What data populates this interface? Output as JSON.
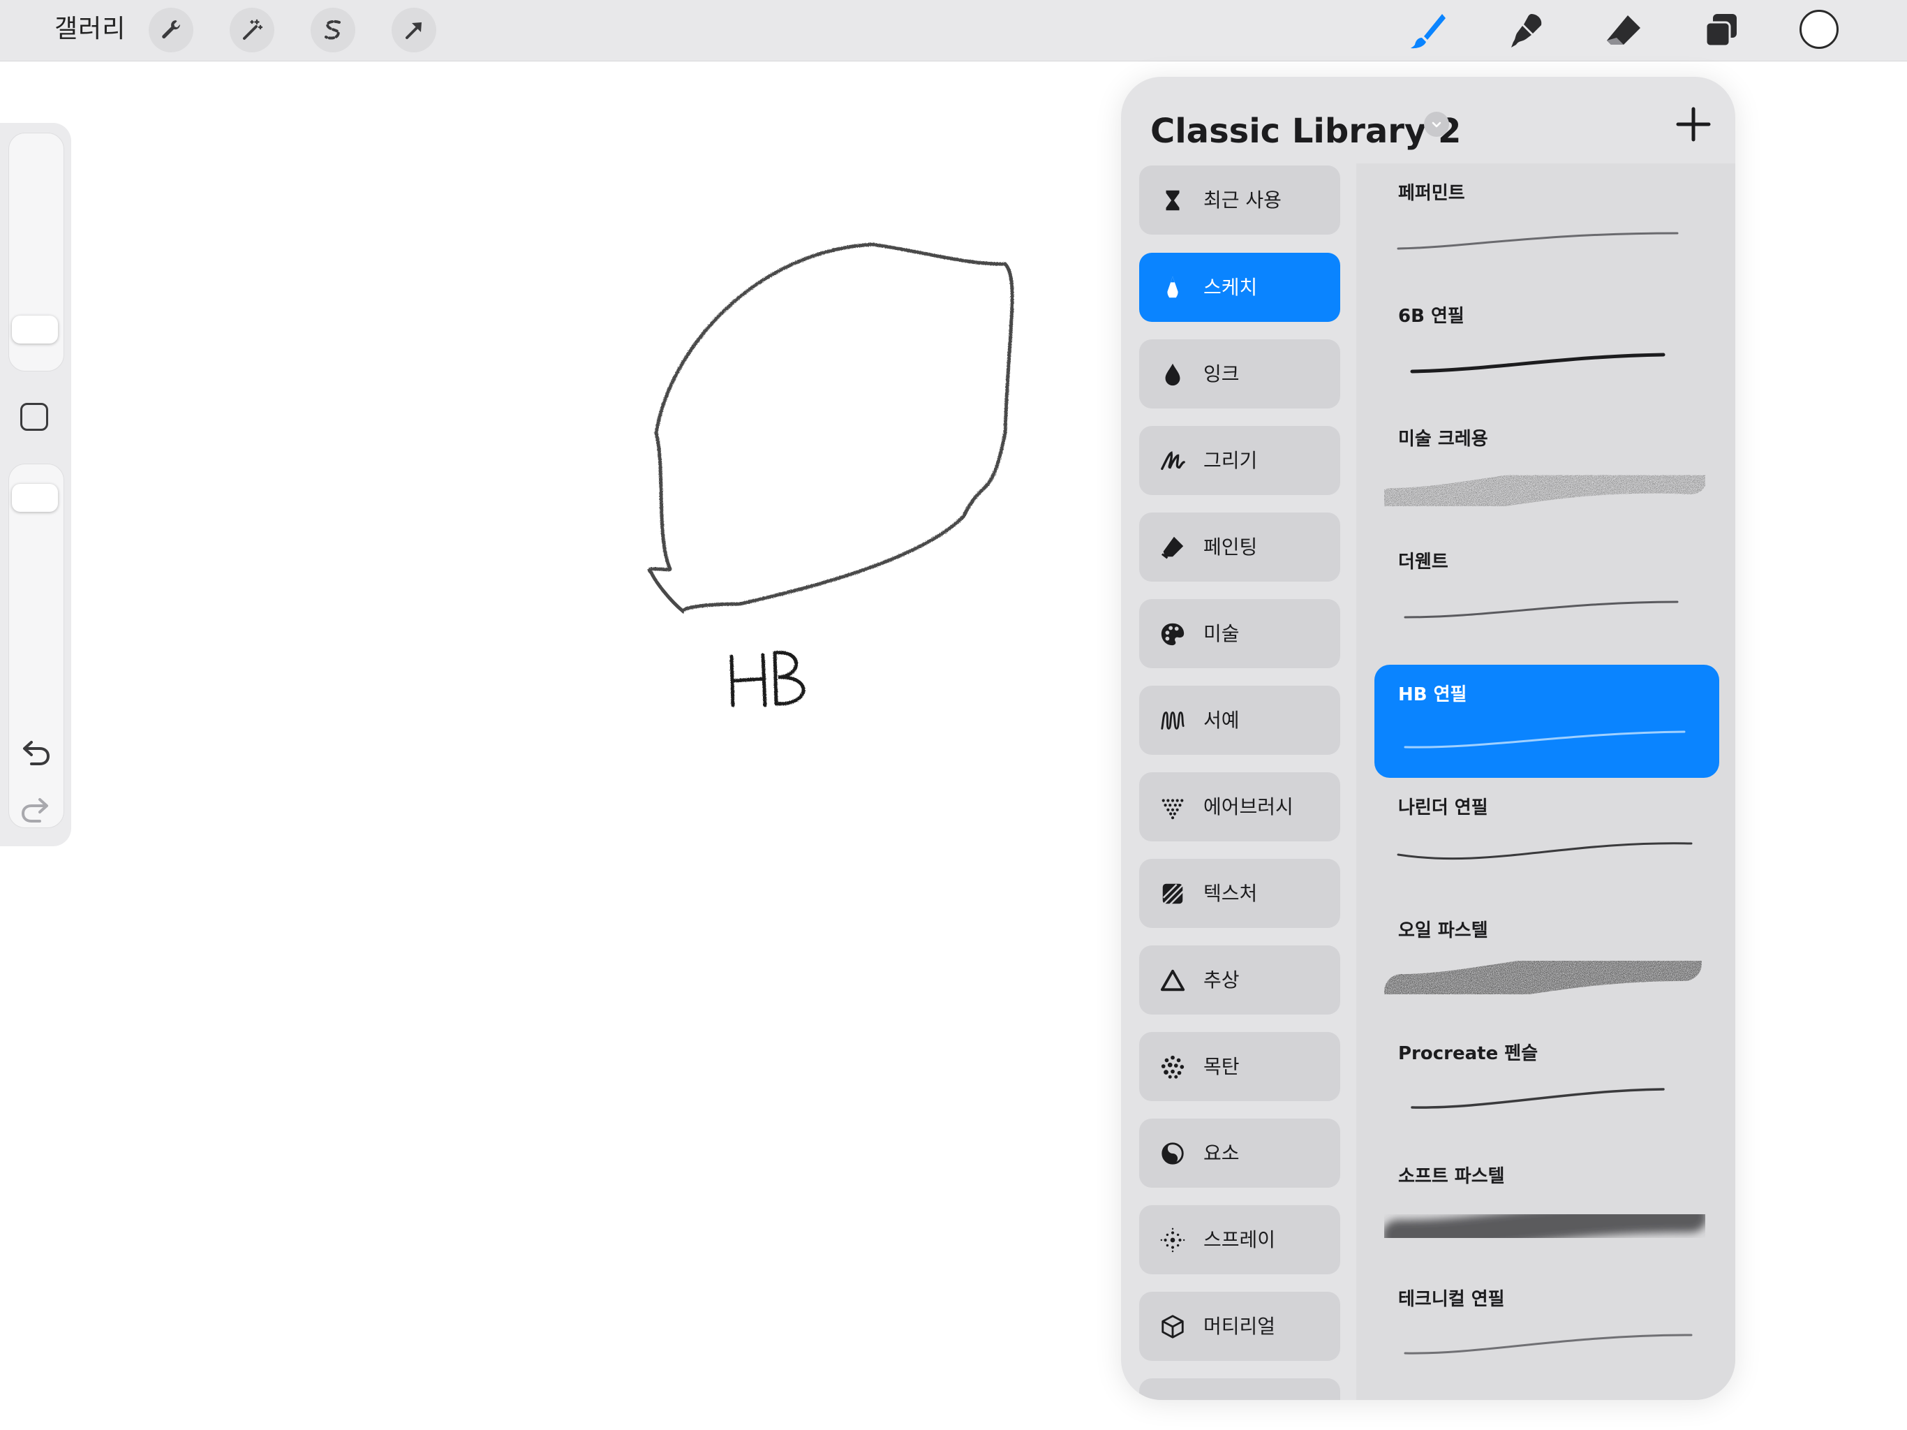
{
  "topbar": {
    "gallery_label": "갤러리",
    "left_tools": [
      {
        "name": "actions",
        "icon": "wrench-icon"
      },
      {
        "name": "adjustments",
        "icon": "magic-wand-icon"
      },
      {
        "name": "selection",
        "icon": "selection-s-icon"
      },
      {
        "name": "transform",
        "icon": "transform-arrow-icon"
      }
    ],
    "right_tools": [
      {
        "name": "paint",
        "icon": "paintbrush-icon",
        "active": true
      },
      {
        "name": "smudge",
        "icon": "smudge-icon"
      },
      {
        "name": "erase",
        "icon": "eraser-icon"
      },
      {
        "name": "layers",
        "icon": "layers-icon"
      },
      {
        "name": "color",
        "icon": "color-swatch"
      }
    ],
    "accent_color": "#0a84ff",
    "current_color": "#ffffff"
  },
  "sidebar": {
    "brush_size_level": 0.12,
    "opacity_level": 0.95
  },
  "canvas": {
    "drawing_text": "HB"
  },
  "panel": {
    "title": "Classic Library 2",
    "categories": [
      {
        "label": "최근 사용",
        "icon": "hourglass-icon"
      },
      {
        "label": "스케치",
        "icon": "pencil-tip-icon",
        "selected": true
      },
      {
        "label": "잉크",
        "icon": "ink-drop-icon"
      },
      {
        "label": "그리기",
        "icon": "scribble-icon"
      },
      {
        "label": "페인팅",
        "icon": "paint-stroke-icon"
      },
      {
        "label": "미술",
        "icon": "palette-icon"
      },
      {
        "label": "서예",
        "icon": "calligraphy-icon"
      },
      {
        "label": "에어브러시",
        "icon": "airbrush-icon"
      },
      {
        "label": "텍스처",
        "icon": "texture-icon"
      },
      {
        "label": "추상",
        "icon": "triangle-icon"
      },
      {
        "label": "목탄",
        "icon": "charcoal-dots-icon"
      },
      {
        "label": "요소",
        "icon": "yin-yang-icon"
      },
      {
        "label": "스프레이",
        "icon": "spray-dots-icon"
      },
      {
        "label": "머티리얼",
        "icon": "cube-icon"
      }
    ],
    "brushes": [
      {
        "name": "페퍼민트"
      },
      {
        "name": "6B 연필"
      },
      {
        "name": "미술 크레용"
      },
      {
        "name": "더웬트"
      },
      {
        "name": "HB 연필",
        "selected": true
      },
      {
        "name": "나린더 연필"
      },
      {
        "name": "오일 파스텔"
      },
      {
        "name": "Procreate 펜슬"
      },
      {
        "name": "소프트 파스텔"
      },
      {
        "name": "테크니컬 연필"
      }
    ]
  }
}
